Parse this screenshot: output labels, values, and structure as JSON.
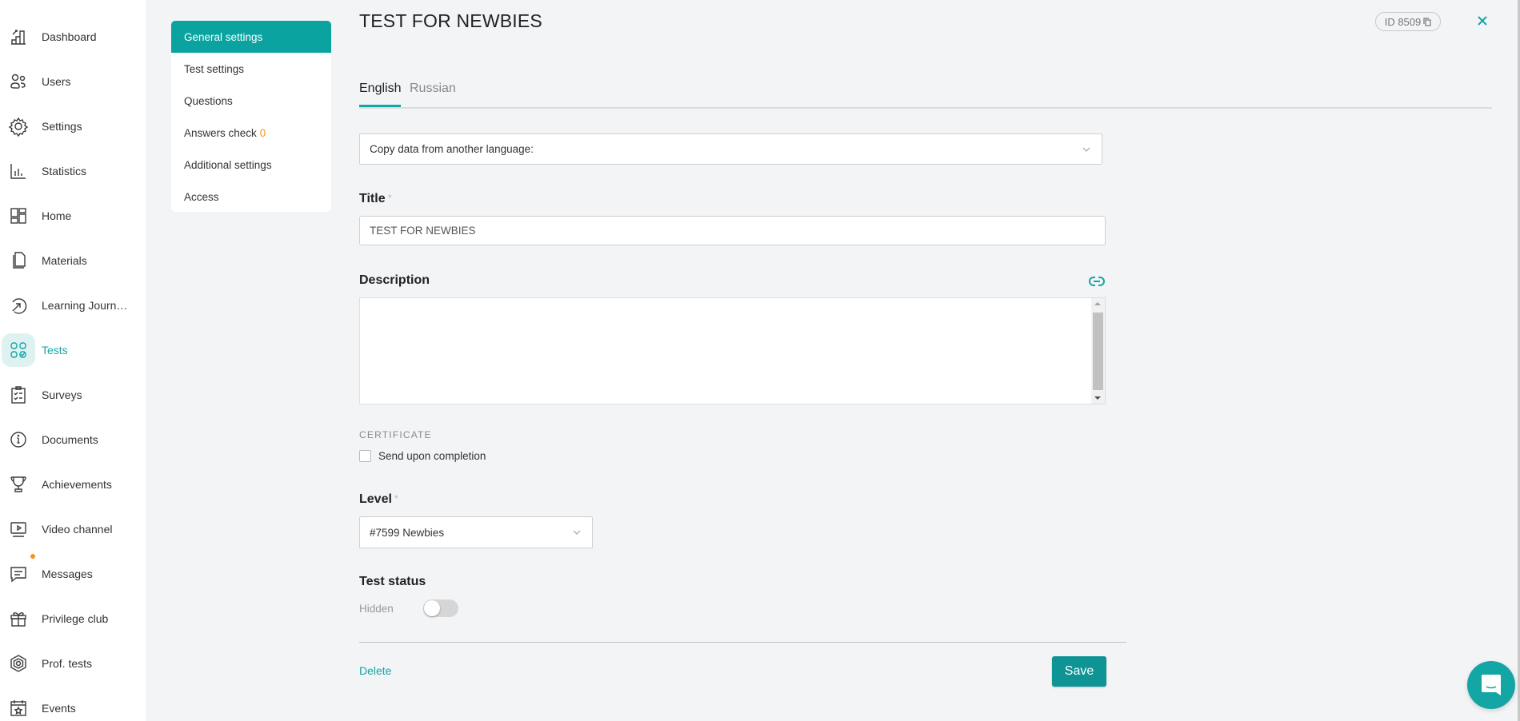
{
  "sidebar": {
    "items": [
      {
        "label": "Dashboard",
        "icon": "dashboard-icon"
      },
      {
        "label": "Users",
        "icon": "users-icon"
      },
      {
        "label": "Settings",
        "icon": "gear-icon"
      },
      {
        "label": "Statistics",
        "icon": "bar-chart-icon"
      },
      {
        "label": "Home",
        "icon": "layout-icon"
      },
      {
        "label": "Materials",
        "icon": "document-copy-icon"
      },
      {
        "label": "Learning Journ…",
        "icon": "arrow-circle-icon"
      },
      {
        "label": "Tests",
        "icon": "tests-grid-icon",
        "active": true
      },
      {
        "label": "Surveys",
        "icon": "clipboard-checklist-icon"
      },
      {
        "label": "Documents",
        "icon": "info-circle-icon"
      },
      {
        "label": "Achievements",
        "icon": "trophy-icon"
      },
      {
        "label": "Video channel",
        "icon": "monitor-play-icon"
      },
      {
        "label": "Messages",
        "icon": "chat-icon",
        "notification": true
      },
      {
        "label": "Privilege club",
        "icon": "gift-icon"
      },
      {
        "label": "Prof. tests",
        "icon": "hexagon-icon"
      },
      {
        "label": "Events",
        "icon": "calendar-star-icon"
      }
    ]
  },
  "subnav": {
    "items": [
      {
        "label": "General settings",
        "active": true
      },
      {
        "label": "Test settings"
      },
      {
        "label": "Questions"
      },
      {
        "label": "Answers check",
        "count": "0"
      },
      {
        "label": "Additional settings"
      },
      {
        "label": "Access"
      }
    ]
  },
  "header": {
    "title": "TEST FOR NEWBIES",
    "id_label": "ID 8509"
  },
  "tabs": [
    {
      "label": "English",
      "active": true
    },
    {
      "label": "Russian",
      "active": false
    }
  ],
  "form": {
    "copy_select": "Copy data from another language:",
    "title_label": "Title",
    "required_mark": "*",
    "title_value": "TEST FOR NEWBIES",
    "description_label": "Description",
    "description_value": "",
    "certificate_caption": "CERTIFICATE",
    "certificate_checkbox_label": "Send upon completion",
    "certificate_checked": false,
    "level_label": "Level",
    "level_value": "#7599 Newbies",
    "status_label": "Test status",
    "status_value": "Hidden",
    "status_enabled": false
  },
  "footer": {
    "delete_label": "Delete",
    "save_label": "Save"
  },
  "colors": {
    "accent": "#14a5a5",
    "active_subnav": "#0aa3a0",
    "save_button": "#0e9494",
    "notification": "#f7931e"
  }
}
